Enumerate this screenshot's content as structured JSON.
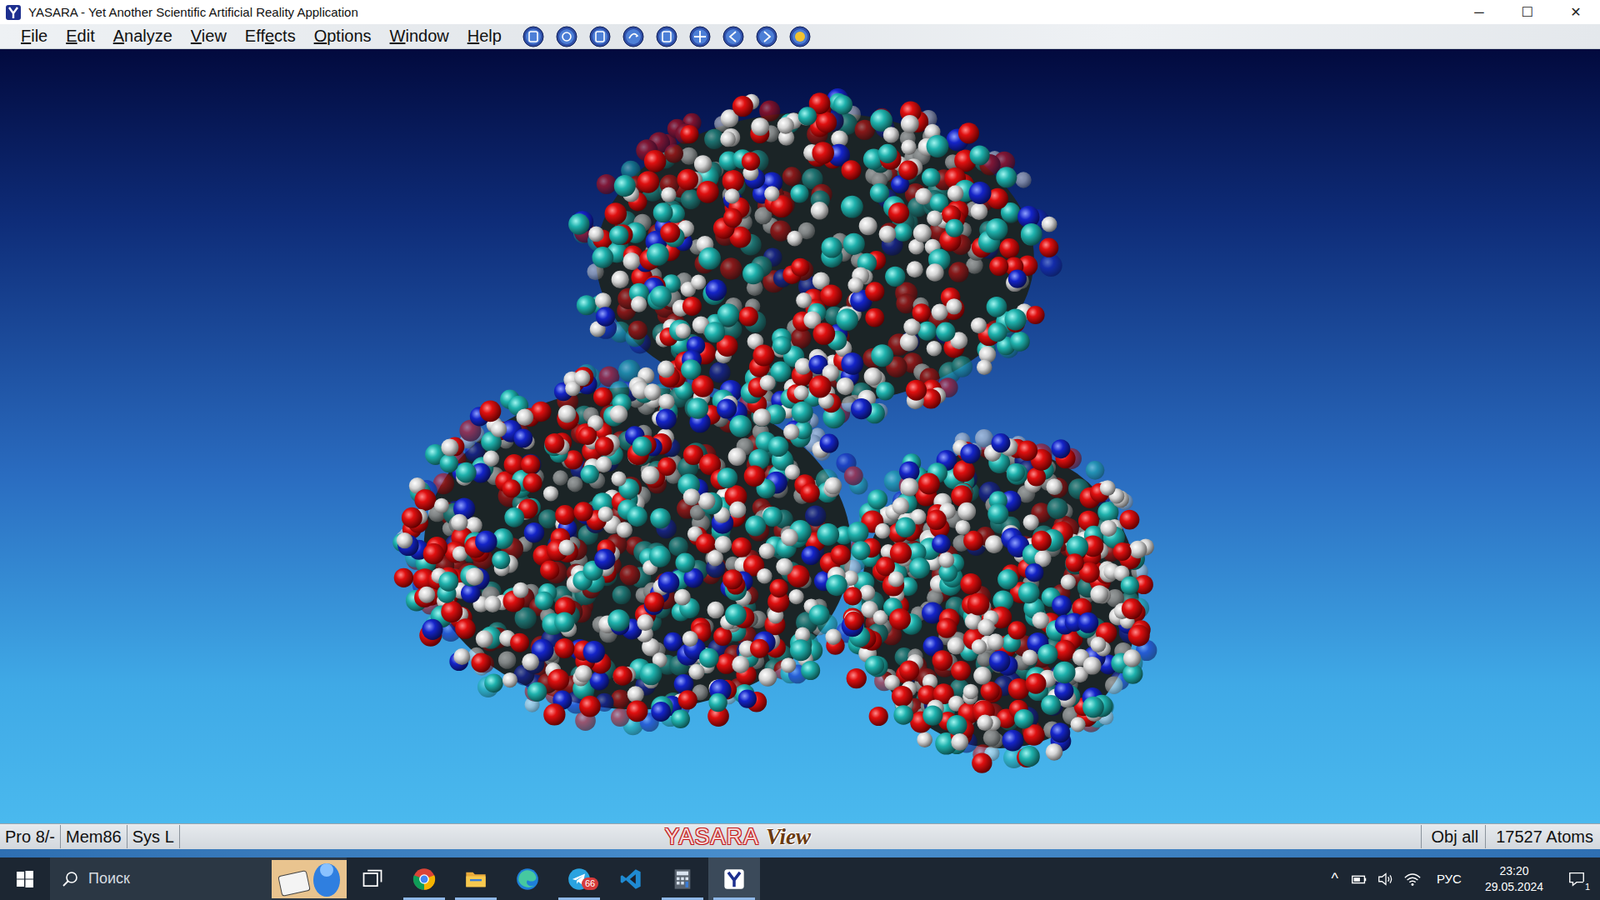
{
  "window": {
    "title": "YASARA - Yet Another Scientific Artificial Reality Application",
    "controls": [
      "─",
      "☐",
      "✕"
    ]
  },
  "menu": [
    {
      "label": "File",
      "mnemonic": 0
    },
    {
      "label": "Edit",
      "mnemonic": 0
    },
    {
      "label": "Analyze",
      "mnemonic": 0
    },
    {
      "label": "View",
      "mnemonic": 0
    },
    {
      "label": "Effects",
      "mnemonic": 3
    },
    {
      "label": "Options",
      "mnemonic": 0
    },
    {
      "label": "Window",
      "mnemonic": 0
    },
    {
      "label": "Help",
      "mnemonic": 0
    }
  ],
  "status_bar": {
    "cells_left": [
      "Pro 8/-",
      "Mem86",
      "Sys L"
    ],
    "logo": {
      "brand": "YASARA",
      "edition": "View"
    },
    "cells_right": [
      "Obj all",
      "17527 Atoms"
    ]
  },
  "taskbar": {
    "search_placeholder": "Поиск",
    "apps": [
      {
        "kind": "taskview",
        "open": false,
        "active": false,
        "badge": ""
      },
      {
        "kind": "chrome",
        "open": true,
        "active": false,
        "badge": ""
      },
      {
        "kind": "explorer",
        "open": true,
        "active": false,
        "badge": ""
      },
      {
        "kind": "edge",
        "open": false,
        "active": false,
        "badge": ""
      },
      {
        "kind": "telegram",
        "open": true,
        "active": false,
        "badge": "66"
      },
      {
        "kind": "vscode",
        "open": false,
        "active": false,
        "badge": ""
      },
      {
        "kind": "calculator",
        "open": true,
        "active": false,
        "badge": ""
      },
      {
        "kind": "yasara",
        "open": true,
        "active": true,
        "badge": ""
      }
    ]
  },
  "tray": {
    "chevron": "^",
    "language": "РУС",
    "time": "23:20",
    "date": "29.05.2024",
    "notifications": "1"
  }
}
